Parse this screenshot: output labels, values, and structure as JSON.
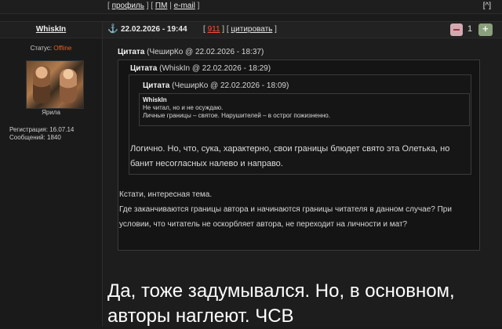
{
  "top_links": {
    "profile": "профиль",
    "pm": "ПМ",
    "email": "e-mail",
    "up": "^"
  },
  "author": {
    "name": "WhiskIn",
    "status_label": "Статус:",
    "status_value": "Offline",
    "rank": "Ярила",
    "reg_label": "Регистрация:",
    "reg_date": "16.07.14",
    "posts_label": "Сообщений:",
    "posts_count": "1840"
  },
  "post": {
    "anchor_icon": "anchor-icon",
    "datetime": "22.02.2026 - 19:44",
    "post_number": "911",
    "cite_label": "цитировать",
    "rating": {
      "count": "1",
      "minus_icon": "minus-icon",
      "plus_icon": "plus-icon"
    }
  },
  "quote1": {
    "label": "Цитата",
    "meta": "(ЧеширКо @ 22.02.2026 - 18:37)",
    "text": "Кстати, интересная тема.\nГде заканчиваются границы автора и начинаются границы читателя в данном случае? При условии, что читатель не оскорбляет автора, не переходит на личности и мат?"
  },
  "quote2": {
    "label": "Цитата",
    "meta": "(WhiskIn @ 22.02.2026 - 18:29)",
    "text": "Логично. Но, что, сука, характерно, свои границы блюдет свято эта Олетька, но банит несогласных налево и направо."
  },
  "quote3": {
    "label": "Цитата",
    "meta": "(ЧеширКо @ 22.02.2026 - 18:09)",
    "author": "WhiskIn",
    "line1": "Не читал, но и не осуждаю.",
    "line2": "Личные границы – святое. Нарушителей – в острог пожизненно."
  },
  "post_body": "Да, тоже задумывался. Но, в основном, авторы наглеют. ЧСВ"
}
